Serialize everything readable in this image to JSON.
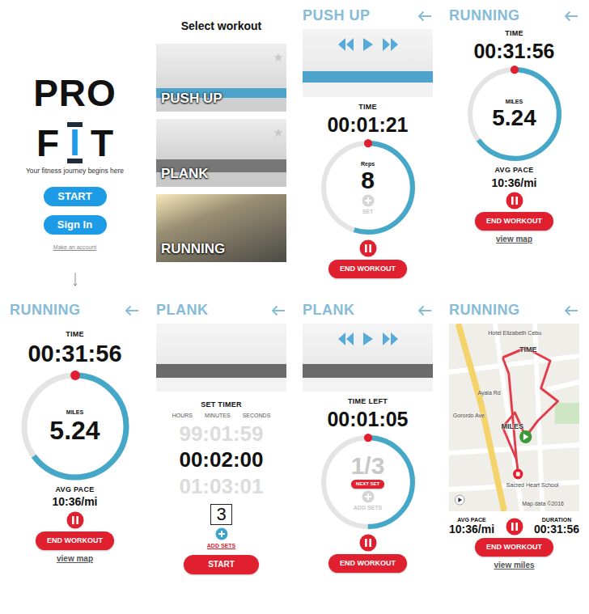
{
  "screens": [
    {
      "kind": "splash",
      "logo_top": "PRO",
      "logo_bottom": [
        "F",
        "I",
        "T"
      ],
      "tagline": "Your fitness journey begins here",
      "buttons": [
        "START",
        "Sign In"
      ],
      "link": "Make an account"
    },
    {
      "kind": "select",
      "title": "Select workout",
      "workouts": [
        {
          "label": "PUSH UP",
          "starred": true
        },
        {
          "label": "PLANK",
          "starred": true
        },
        {
          "label": "RUNNING",
          "starred": false
        }
      ]
    },
    {
      "kind": "pushup",
      "title": "PUSH UP",
      "time_label": "TIME",
      "time": "00:01:21",
      "counter_label": "Reps",
      "count": "8",
      "level": 0.55,
      "add_label": "SET",
      "add_enabled": false,
      "end_button": "END WORKOUT"
    },
    {
      "kind": "running",
      "title": "RUNNING",
      "time_label": "TIME",
      "time": "00:31:56",
      "distance_label": "MILES",
      "distance": "5.24",
      "level": 0.65,
      "pace_label": "AVG PACE",
      "pace": "10:36/mi",
      "end_button": "END WORKOUT",
      "link": "view map"
    },
    {
      "kind": "running",
      "title": "RUNNING",
      "time_label": "TIME",
      "time": "00:31:56",
      "distance_label": "MILES",
      "distance": "5.24",
      "level": 0.65,
      "pace_label": "AVG PACE",
      "pace": "10:36/mi",
      "end_button": "END WORKOUT",
      "link": "view map"
    },
    {
      "kind": "plank_setup",
      "title": "PLANK",
      "heading": "SET TIMER",
      "units": [
        "HOURS",
        "MINUTES",
        "SECONDS"
      ],
      "timer_rows": [
        {
          "text": "99:01:59",
          "selected": false
        },
        {
          "text": "00:02:00",
          "selected": true
        },
        {
          "text": "01:03:01",
          "selected": false
        }
      ],
      "sets": "3",
      "add_label": "ADD SETS",
      "add_enabled": true,
      "start_button": "START"
    },
    {
      "kind": "plank_timer",
      "title": "PLANK",
      "time_label": "TIME LEFT",
      "time": "00:01:05",
      "sets_progress": "1/3",
      "next_button": "NEXT SET",
      "add_label": "ADD SETS",
      "add_enabled": false,
      "level": 0.5,
      "end_button": "END WORKOUT"
    },
    {
      "kind": "running_map",
      "title": "RUNNING",
      "map": {
        "overlay_labels": [
          "TIME",
          "MILES"
        ],
        "labels": [
          "Hotel Elizabeth Cebu",
          "Gorordo Ave",
          "Ayala Rd",
          "Sacred Heart School",
          "Map data ©2016"
        ]
      },
      "pace_label": "AVG PACE",
      "pace": "10:36/mi",
      "duration_label": "DURATION",
      "duration": "00:31:56",
      "end_button": "END WORKOUT",
      "link": "view miles"
    }
  ]
}
